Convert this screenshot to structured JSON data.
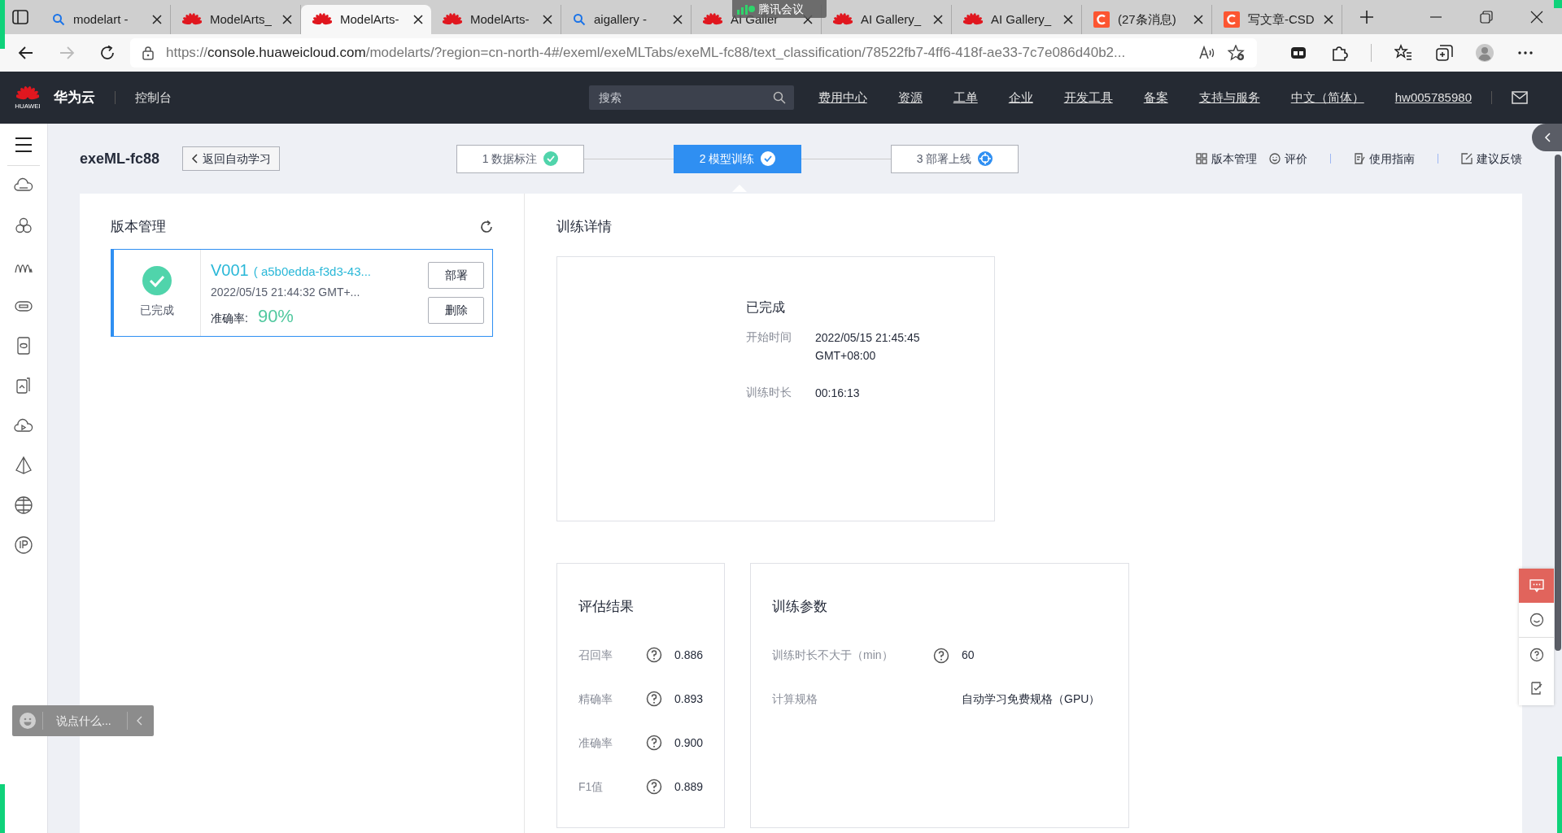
{
  "browser": {
    "tabs": [
      {
        "title": "modelart -",
        "kind": "search",
        "selected": false
      },
      {
        "title": "ModelArts_",
        "kind": "huawei",
        "selected": false
      },
      {
        "title": "ModelArts-",
        "kind": "huawei",
        "selected": true
      },
      {
        "title": "ModelArts-",
        "kind": "huawei",
        "selected": false
      },
      {
        "title": "aigallery -",
        "kind": "search",
        "selected": false
      },
      {
        "title": "AI Galler",
        "kind": "huawei",
        "selected": false
      },
      {
        "title": "AI Gallery_",
        "kind": "huawei",
        "selected": false
      },
      {
        "title": "AI Gallery_",
        "kind": "huawei",
        "selected": false
      },
      {
        "title": "(27条消息)",
        "kind": "csdn",
        "selected": false
      },
      {
        "title": "写文章-CSD",
        "kind": "csdn",
        "selected": false
      }
    ],
    "meeting_overlay": "腾讯会议",
    "url_parts": [
      {
        "text": "https://",
        "emphasis": false
      },
      {
        "text": "console.huaweicloud.com",
        "emphasis": true
      },
      {
        "text": "/modelarts/?region=cn-north-4#/exeml/exeMLTabs/exeML-fc88/text_classification/78522fb7-4ff6-418f-ae33-7c7e086d40b2...",
        "emphasis": false
      }
    ]
  },
  "header": {
    "logo_text": "HUAWEI",
    "brand": "华为云",
    "console": "控制台",
    "search_placeholder": "搜索",
    "nav": [
      "费用中心",
      "资源",
      "工单",
      "企业",
      "开发工具",
      "备案",
      "支持与服务",
      "中文（简体）"
    ],
    "user": "hw005785980"
  },
  "page": {
    "title": "exeML-fc88",
    "back": "返回自动学习",
    "steps": [
      {
        "number": "1",
        "label": "数据标注",
        "kind": "done",
        "selected": false
      },
      {
        "number": "2",
        "label": "模型训练",
        "kind": "done",
        "selected": true
      },
      {
        "number": "3",
        "label": "部署上线",
        "kind": "pending",
        "selected": false
      }
    ],
    "links": [
      {
        "kind": "grid",
        "label": "版本管理"
      },
      {
        "kind": "smile",
        "label": "评价"
      },
      {
        "kind": "guide",
        "label": "使用指南"
      },
      {
        "kind": "feedback",
        "label": "建议反馈"
      }
    ]
  },
  "versions": {
    "title": "版本管理",
    "items": [
      {
        "status": "已完成",
        "name": "V001",
        "id": "( a5b0edda-f3d3-43...",
        "time": "2022/05/15 21:44:32 GMT+...",
        "accuracy_label": "准确率:",
        "accuracy": "90%",
        "actions": [
          "部署",
          "删除"
        ],
        "selected": true
      }
    ]
  },
  "details": {
    "title": "训练详情",
    "status": "已完成",
    "rows": [
      {
        "label": "开始时间",
        "value": "2022/05/15 21:45:45 GMT+08:00"
      },
      {
        "label": "训练时长",
        "value": "00:16:13"
      }
    ]
  },
  "evaluation": {
    "title": "评估结果",
    "rows": [
      {
        "label": "召回率",
        "value": "0.886"
      },
      {
        "label": "精确率",
        "value": "0.893"
      },
      {
        "label": "准确率",
        "value": "0.900"
      },
      {
        "label": "F1值",
        "value": "0.889"
      }
    ]
  },
  "params": {
    "title": "训练参数",
    "rows": [
      {
        "label": "训练时长不大于（min）",
        "value": "60",
        "help": true
      },
      {
        "label": "计算规格",
        "value": "自动学习免费规格（GPU）",
        "help": false
      }
    ]
  },
  "chat": {
    "placeholder": "说点什么..."
  }
}
